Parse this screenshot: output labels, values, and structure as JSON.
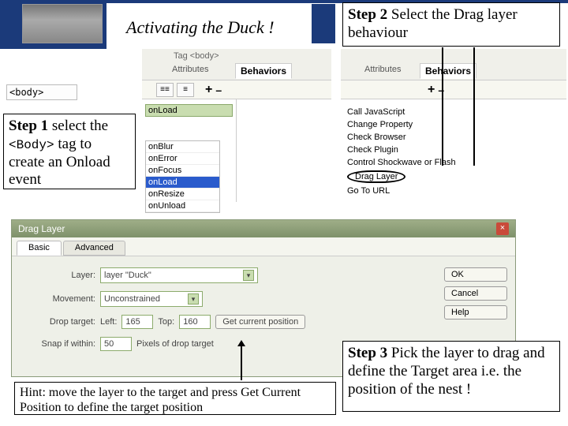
{
  "title": "Activating the Duck !",
  "step1": {
    "lead": "Step 1",
    "rest_a": " select the ",
    "tag": "<Body>",
    "rest_b": " tag to create an Onload event"
  },
  "step2": {
    "lead": "Step 2",
    "rest": " Select the Drag layer behaviour"
  },
  "step3": {
    "lead": "Step 3",
    "rest": " Pick the layer to drag and define the Target area i.e. the position of the nest !"
  },
  "hint": "Hint: move the layer to the target and press Get Current Position to define the target position",
  "body_tag": "<body>",
  "panel": {
    "tag_title": "Tag <body>",
    "tab_attr": "Attributes",
    "tab_beh": "Behaviors",
    "plus": "+",
    "minus": "–",
    "event_selected": "onLoad",
    "events": [
      "onBlur",
      "onError",
      "onFocus",
      "onLoad",
      "onResize",
      "onUnload"
    ]
  },
  "behaviors": [
    "Call JavaScript",
    "Change Property",
    "Check Browser",
    "Check Plugin",
    "Control Shockwave or Flash",
    "Drag Layer",
    "Go To URL"
  ],
  "dialog": {
    "title": "Drag Layer",
    "tabs": {
      "basic": "Basic",
      "advanced": "Advanced"
    },
    "rows": {
      "layer_lbl": "Layer:",
      "layer_val": "layer \"Duck\"",
      "move_lbl": "Movement:",
      "move_val": "Unconstrained",
      "drop_lbl": "Drop target:",
      "left_lbl": "Left:",
      "left_val": "165",
      "top_lbl": "Top:",
      "160": "160",
      "getpos": "Get current position",
      "snap_lbl": "Snap if within:",
      "snap_val": "50",
      "snap_unit": "Pixels of drop target"
    },
    "buttons": {
      "ok": "OK",
      "cancel": "Cancel",
      "help": "Help"
    },
    "close": "×"
  }
}
